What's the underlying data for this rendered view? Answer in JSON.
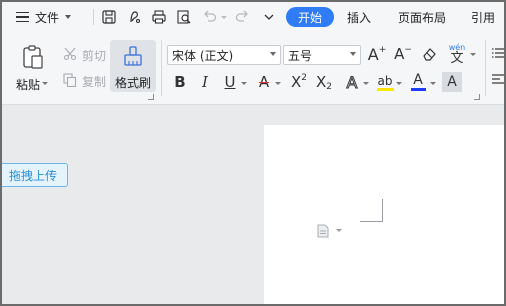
{
  "menubar": {
    "file_label": "文件",
    "tabs": [
      {
        "label": "开始",
        "active": true
      },
      {
        "label": "插入"
      },
      {
        "label": "页面布局"
      },
      {
        "label": "引用"
      }
    ]
  },
  "ribbon": {
    "paste_label": "粘贴",
    "cut_label": "剪切",
    "copy_label": "复制",
    "format_painter_label": "格式刷",
    "font_name": "宋体 (正文)",
    "font_size": "五号",
    "pinyin_glyph": "wén"
  },
  "workspace": {
    "upload_hint": "拖拽上传"
  },
  "colors": {
    "accent": "#2f7cf6",
    "font_color_bar": "#1e3cff",
    "highlight_bar": "#ffe600",
    "upload_border": "#6db7e8"
  }
}
